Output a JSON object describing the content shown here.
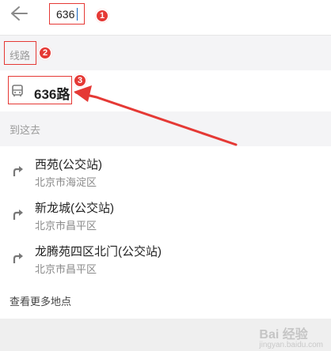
{
  "search": {
    "query": "636"
  },
  "sections": {
    "routes_header": "线路",
    "destinations_header": "到这去"
  },
  "route": {
    "label": "636路"
  },
  "places": [
    {
      "name": "西苑(公交站)",
      "district": "北京市海淀区"
    },
    {
      "name": "新龙城(公交站)",
      "district": "北京市昌平区"
    },
    {
      "name": "龙腾苑四区北门(公交站)",
      "district": "北京市昌平区"
    }
  ],
  "more_link": "查看更多地点",
  "annotations": [
    "1",
    "2",
    "3"
  ],
  "watermark": {
    "title": "Bai 经验",
    "subtitle": "jingyan.baidu.com"
  },
  "colors": {
    "highlight": "#e53935",
    "section_bg": "#f4f4f6",
    "caret": "#1565c0"
  }
}
